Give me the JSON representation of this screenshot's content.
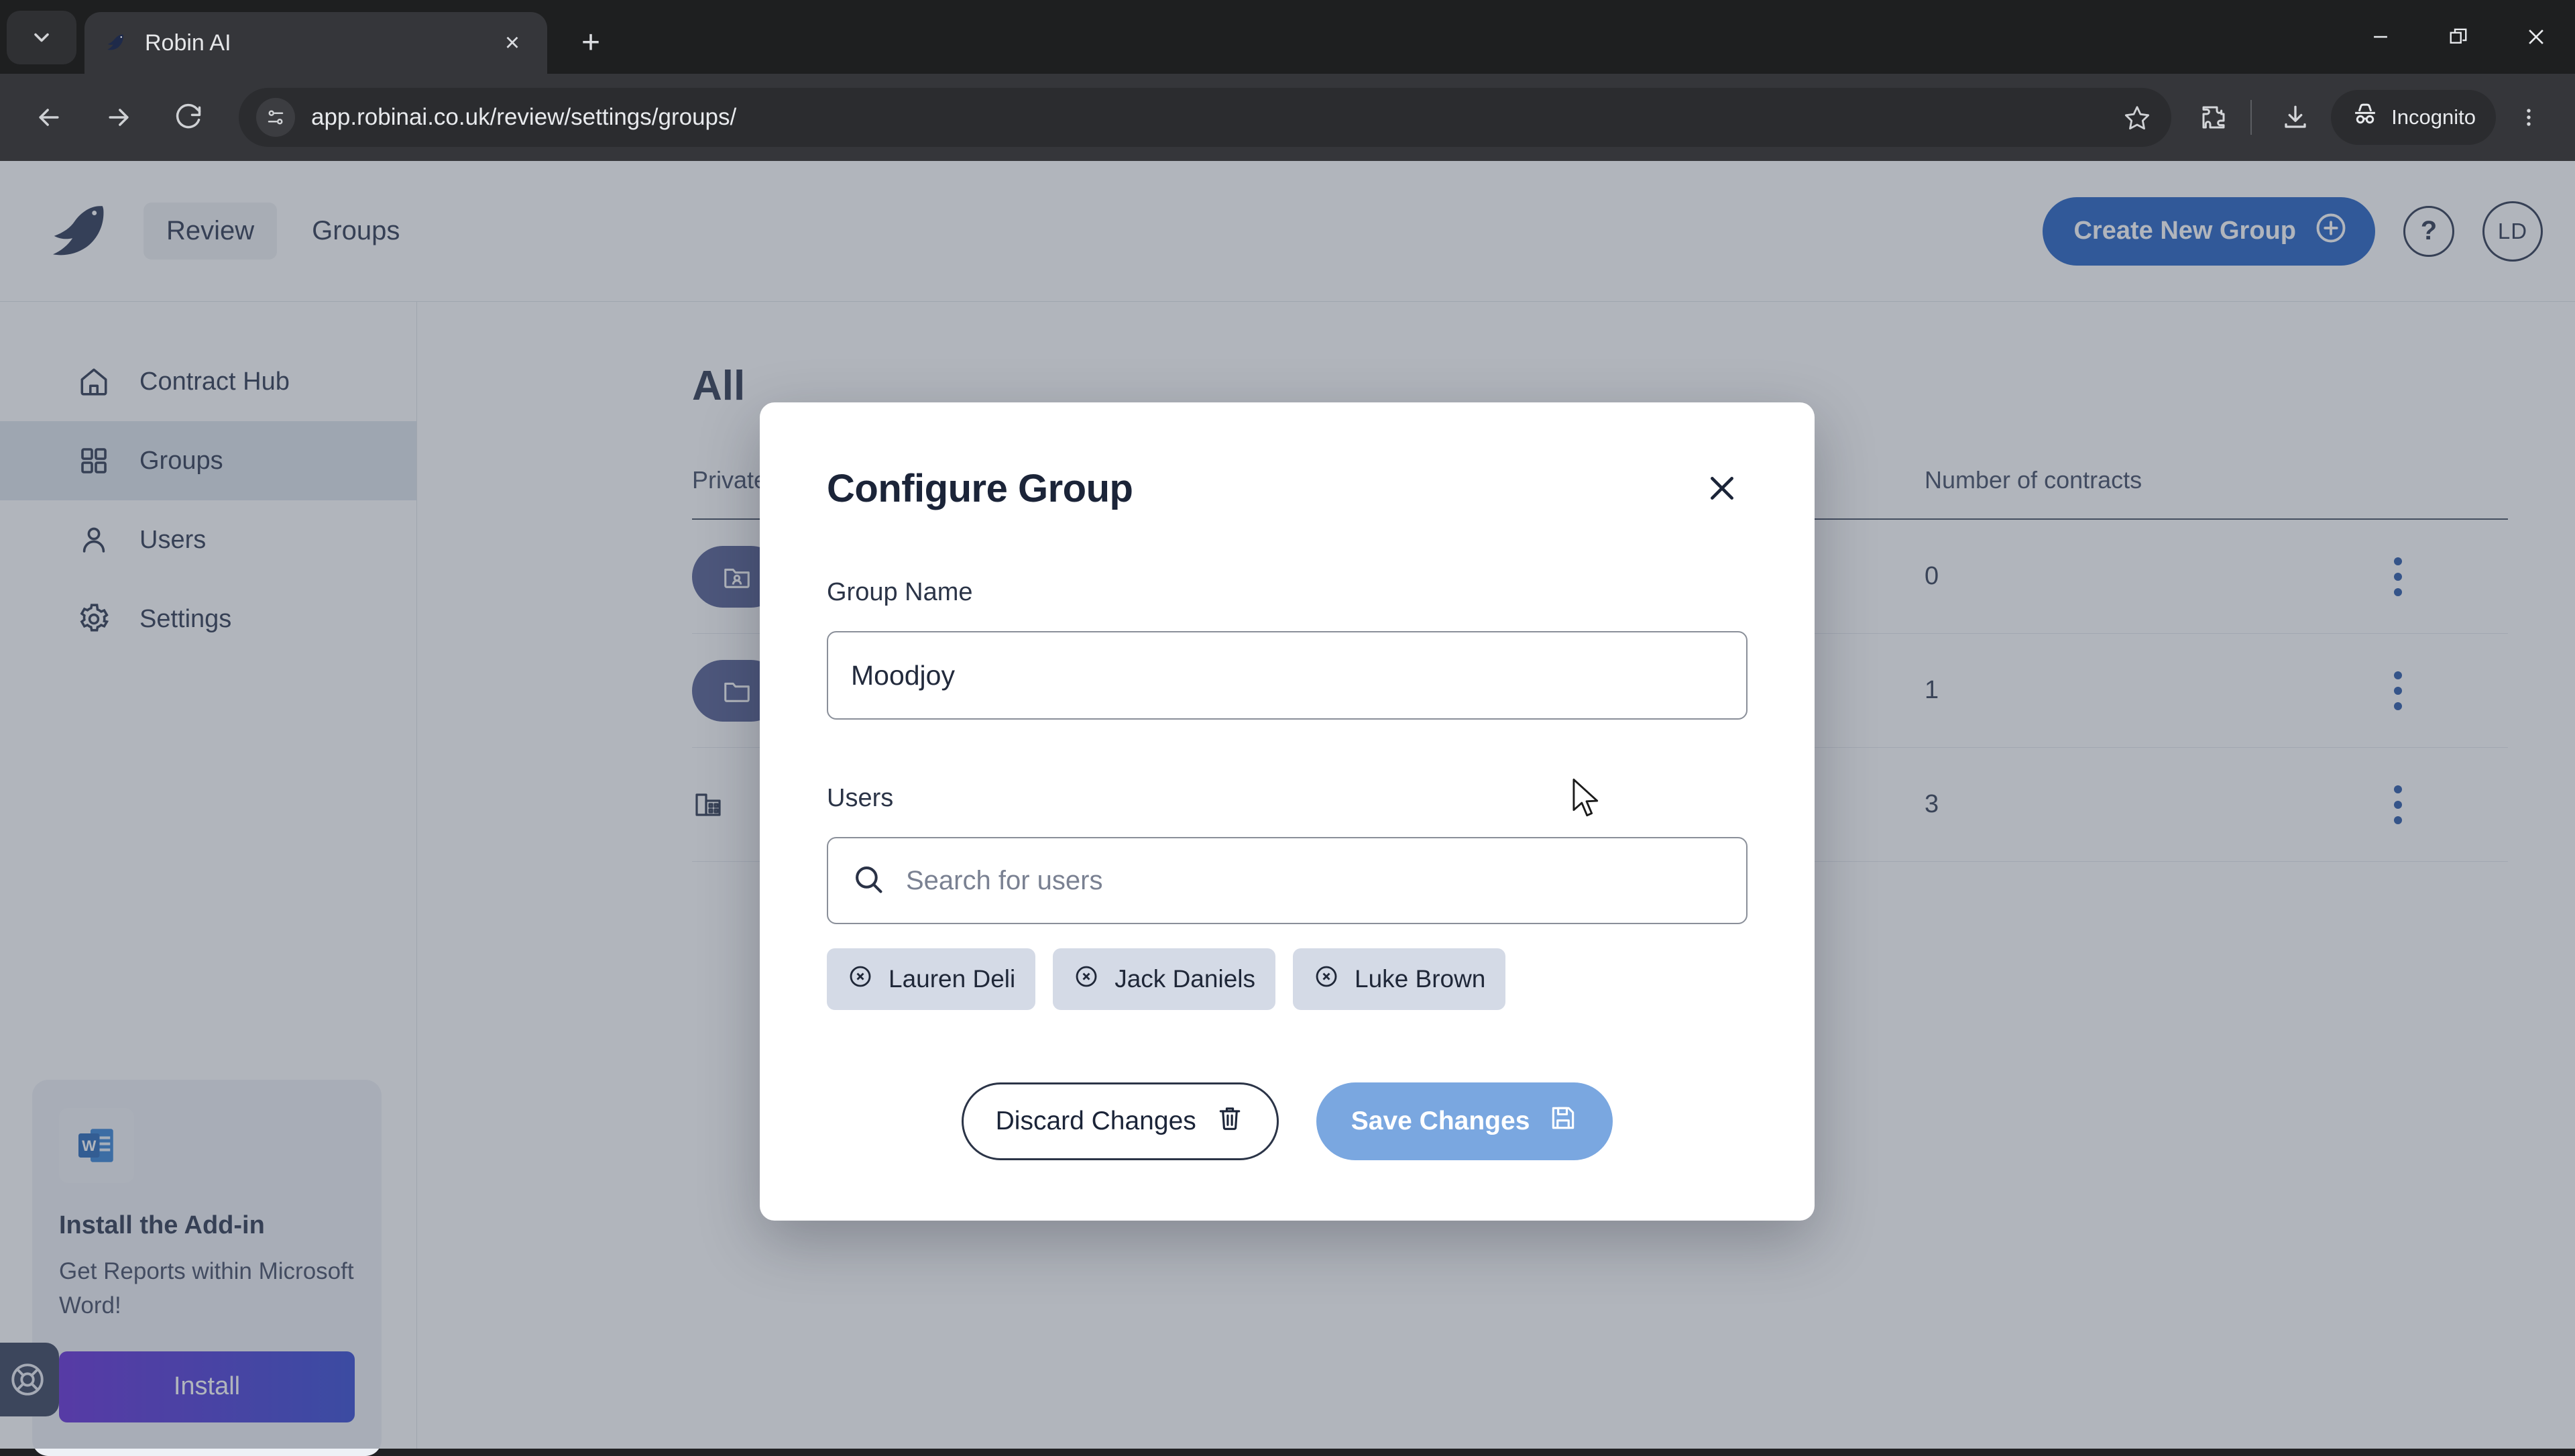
{
  "browser": {
    "tab": {
      "title": "Robin AI",
      "favicon": "robin-bird-favicon"
    },
    "tab_list_icon": "chevron-down-icon",
    "new_tab_label": "+",
    "close_tab_label": "×",
    "window": {
      "minimize": "−",
      "maximize": "restore-icon",
      "close": "×"
    },
    "nav": {
      "back": "back-arrow-icon",
      "forward": "forward-arrow-icon",
      "reload": "reload-icon"
    },
    "omnibox": {
      "site_info_icon": "page-settings-icon",
      "url": "app.robinai.co.uk/review/settings/groups/",
      "bookmark_icon": "star-icon"
    },
    "extensions_icon": "puzzle-icon",
    "downloads_icon": "download-icon",
    "incognito_label": "Incognito",
    "incognito_icon": "incognito-hat-icon",
    "menu_icon": "kebab-menu-icon"
  },
  "app": {
    "header": {
      "logo": "robin-bird-logo",
      "nav": [
        {
          "label": "Review",
          "active": true
        },
        {
          "label": "Groups",
          "active": false
        }
      ],
      "create_button": {
        "label": "Create New Group",
        "icon": "plus-circle-icon",
        "color": "#1758bf"
      },
      "help_icon": "question-mark-icon",
      "avatar_initials": "LD"
    },
    "sidebar": {
      "items": [
        {
          "label": "Contract Hub",
          "icon": "home-icon",
          "active": false
        },
        {
          "label": "Groups",
          "icon": "grid-icon",
          "active": true
        },
        {
          "label": "Users",
          "icon": "user-icon",
          "active": false
        },
        {
          "label": "Settings",
          "icon": "gear-icon",
          "active": false
        }
      ],
      "promo": {
        "icon": "microsoft-word-icon",
        "title": "Install the Add-in",
        "subtitle": "Get Reports within Microsoft Word!",
        "button_label": "Install"
      },
      "help_fab_icon": "lifebuoy-icon"
    },
    "main": {
      "page_title": "All",
      "table": {
        "columns": [
          "Private",
          "Number of contracts",
          ""
        ],
        "rows": [
          {
            "badge_icon": "folder-user-icon",
            "badge_style": "filled",
            "count": "0",
            "menu_icon": "vertical-dots-icon"
          },
          {
            "badge_icon": "folder-icon",
            "badge_style": "filled",
            "count": "1",
            "menu_icon": "vertical-dots-icon"
          },
          {
            "badge_icon": "building-icon",
            "badge_style": "plain",
            "count": "3",
            "menu_icon": "vertical-dots-icon"
          }
        ]
      }
    },
    "modal": {
      "title": "Configure Group",
      "close_icon": "close-icon",
      "group_name_label": "Group Name",
      "group_name_value": "Moodjoy",
      "users_label": "Users",
      "users_search_placeholder": "Search for users",
      "users_search_icon": "search-icon",
      "chips": [
        {
          "label": "Lauren Deli",
          "remove_icon": "circle-x-icon"
        },
        {
          "label": "Jack Daniels",
          "remove_icon": "circle-x-icon"
        },
        {
          "label": "Luke Brown",
          "remove_icon": "circle-x-icon"
        }
      ],
      "discard_button": {
        "label": "Discard Changes",
        "icon": "trash-icon"
      },
      "save_button": {
        "label": "Save Changes",
        "icon": "save-disk-icon",
        "color": "#7aa7e0"
      }
    }
  }
}
